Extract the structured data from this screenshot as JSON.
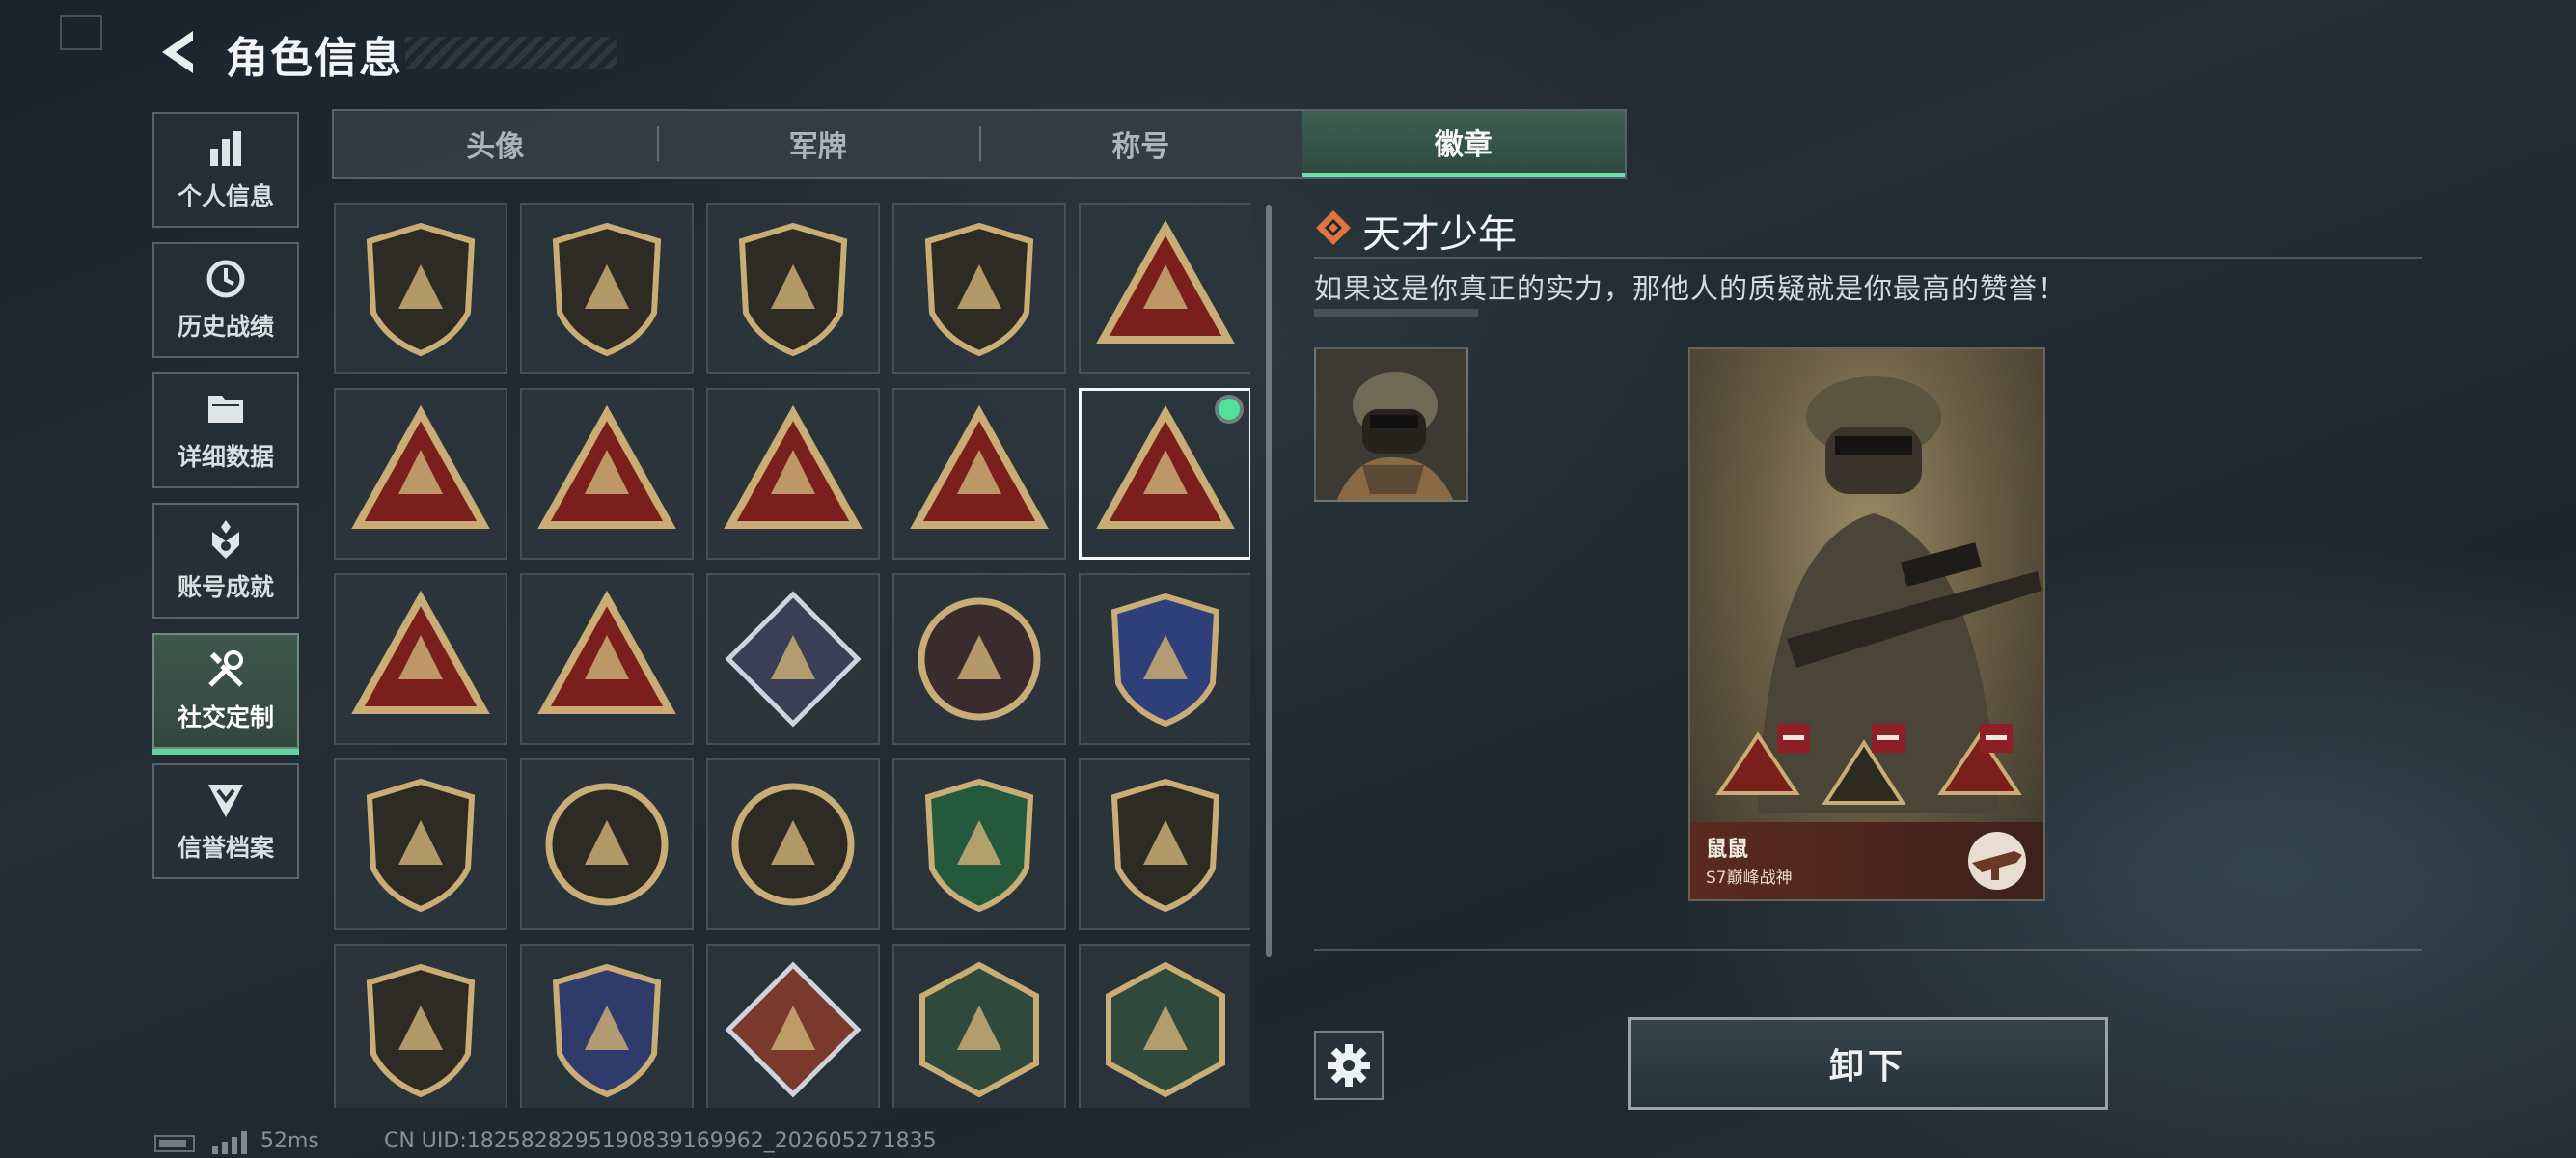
{
  "header": {
    "title": "角色信息"
  },
  "sidebar": {
    "items": [
      {
        "label": "个人信息",
        "icon": "bar-chart-icon"
      },
      {
        "label": "历史战绩",
        "icon": "history-clock-icon"
      },
      {
        "label": "详细数据",
        "icon": "folder-icon"
      },
      {
        "label": "账号成就",
        "icon": "achievement-icon"
      },
      {
        "label": "社交定制",
        "icon": "wrench-screwdriver-icon",
        "active": true
      },
      {
        "label": "信誉档案",
        "icon": "shield-chevron-icon"
      }
    ]
  },
  "tabs": [
    {
      "label": "头像"
    },
    {
      "label": "军牌"
    },
    {
      "label": "称号"
    },
    {
      "label": "徽章",
      "active": true
    }
  ],
  "badges": {
    "selected_index": 9,
    "items": [
      {
        "icon": "triangle-emblem-badge-icon"
      },
      {
        "icon": "helicopter-badge-icon"
      },
      {
        "icon": "diamond-emblem-badge-icon"
      },
      {
        "icon": "dagger-badge-icon"
      },
      {
        "icon": "s7-badge-icon"
      },
      {
        "icon": "s8-badge-icon"
      },
      {
        "icon": "nest-badge-icon"
      },
      {
        "icon": "tank-badge-icon"
      },
      {
        "icon": "number-one-badge-icon"
      },
      {
        "icon": "usb-drive-badge-icon"
      },
      {
        "icon": "figure-badge-icon"
      },
      {
        "icon": "soldiers-badge-icon"
      },
      {
        "icon": "launcher-badge-icon"
      },
      {
        "icon": "star-wreath-badge-icon"
      },
      {
        "icon": "blue-shield-badge-icon"
      },
      {
        "icon": "shield-crystal-badge-icon"
      },
      {
        "icon": "shell-badge-icon"
      },
      {
        "icon": "skull-crosshair-badge-icon"
      },
      {
        "icon": "green-rifle-badge-icon"
      },
      {
        "icon": "smg-badge-icon"
      },
      {
        "icon": "pistol-badge-icon"
      },
      {
        "icon": "knife-target-badge-icon"
      },
      {
        "icon": "wolf-badge-icon"
      },
      {
        "icon": "wasp-badge-icon"
      },
      {
        "icon": "medic-hand-badge-icon"
      }
    ]
  },
  "detail": {
    "name": "天才少年",
    "description": "如果这是你真正的实力，那他人的质疑就是你最高的赞誉！"
  },
  "card": {
    "player_name": "鼠鼠",
    "player_title": "S7巅峰战神"
  },
  "actions": {
    "unequip_label": "卸下"
  },
  "status": {
    "ping": "52ms",
    "uid": "CN UID:1825828295190839169962_202605271835"
  },
  "colors": {
    "accent_green": "#5fd3a0",
    "badge_gold": "#c9ad74",
    "badge_red": "#7a1f1c"
  }
}
